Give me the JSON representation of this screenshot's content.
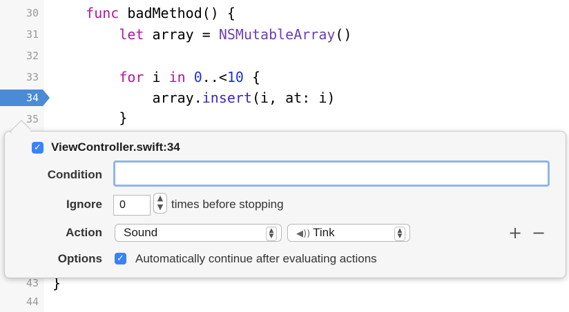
{
  "editor": {
    "line_numbers": [
      "30",
      "31",
      "32",
      "33",
      "34",
      "35",
      "43",
      "44"
    ],
    "lines": {
      "l30": {
        "kw": "func",
        "rest": " badMethod() {"
      },
      "l31": {
        "kw": "let",
        "mid": " array = ",
        "cls": "NSMutableArray",
        "end": "()"
      },
      "l33": {
        "kw1": "for",
        "mid1": " i ",
        "kw2": "in",
        "mid2": " ",
        "num1": "0",
        "mid3": "..<",
        "num2": "10",
        "end": " {"
      },
      "l34": {
        "pre": "array.",
        "fn": "insert",
        "end": "(i, at: i)"
      },
      "l35": {
        "text": "}"
      },
      "l43": {
        "text": "}"
      }
    }
  },
  "breakpoint_popover": {
    "title": "ViewController.swift:34",
    "enabled": true,
    "condition_label": "Condition",
    "condition_value": "",
    "ignore_label": "Ignore",
    "ignore_value": "0",
    "ignore_suffix": "times before stopping",
    "action_label": "Action",
    "action_type": "Sound",
    "sound_name": "Tink",
    "add_symbol": "+",
    "remove_symbol": "−",
    "options_label": "Options",
    "options_text": "Automatically continue after evaluating actions",
    "options_checked": true
  },
  "colors": {
    "breakpoint": "#4b8ad6",
    "accent": "#3a82f7",
    "keyword": "#b3169f",
    "class": "#6b3fb3",
    "number": "#1c31d4"
  },
  "icons": {
    "check": "checkmark-icon",
    "speaker": "speaker-icon",
    "popup": "chevron-updown-icon"
  }
}
